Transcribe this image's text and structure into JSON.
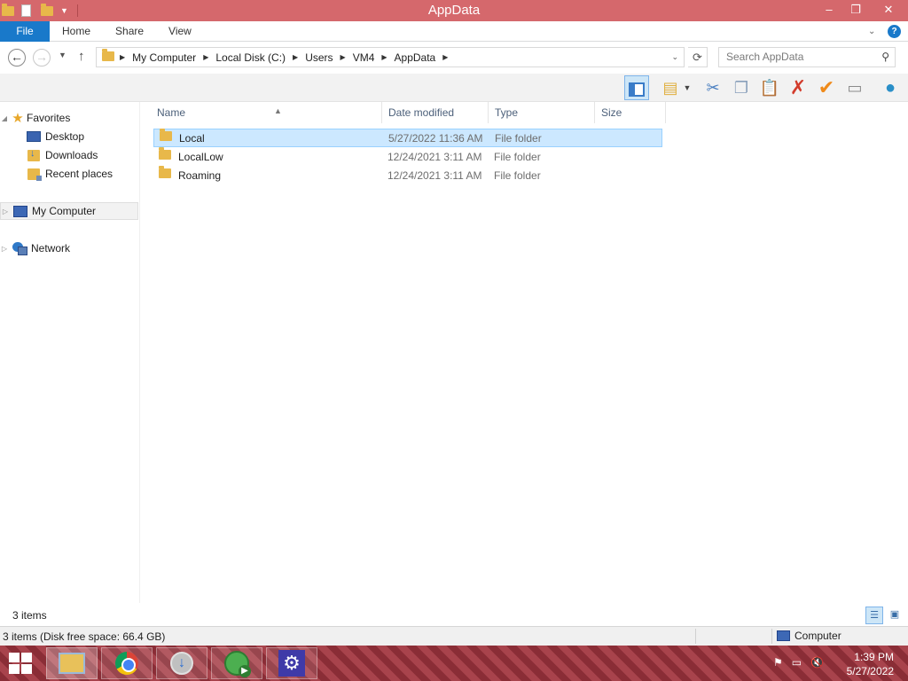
{
  "window": {
    "title": "AppData"
  },
  "ribbon": {
    "tabs": [
      "File",
      "Home",
      "Share",
      "View"
    ]
  },
  "address": {
    "breadcrumbs": [
      "My Computer",
      "Local Disk (C:)",
      "Users",
      "VM4",
      "AppData"
    ],
    "search_placeholder": "Search AppData"
  },
  "nav": {
    "favorites": "Favorites",
    "favorites_items": [
      "Desktop",
      "Downloads",
      "Recent places"
    ],
    "my_computer": "My Computer",
    "network": "Network"
  },
  "list": {
    "columns": [
      "Name",
      "Date modified",
      "Type",
      "Size"
    ],
    "rows": [
      {
        "name": "Local",
        "date": "5/27/2022 11:36 AM",
        "type": "File folder",
        "size": "",
        "selected": true
      },
      {
        "name": "LocalLow",
        "date": "12/24/2021 3:11 AM",
        "type": "File folder",
        "size": "",
        "selected": false
      },
      {
        "name": "Roaming",
        "date": "12/24/2021 3:11 AM",
        "type": "File folder",
        "size": "",
        "selected": false
      }
    ]
  },
  "status": {
    "items_count": "3 items",
    "detail": "3 items (Disk free space: 66.4 GB)",
    "location": "Computer"
  },
  "taskbar": {
    "time": "1:39 PM",
    "date": "5/27/2022"
  },
  "colors": {
    "titlebar": "#d5686c",
    "file_tab": "#1979ca",
    "selection": "#cce8ff",
    "taskbar": "#8a2d36"
  }
}
